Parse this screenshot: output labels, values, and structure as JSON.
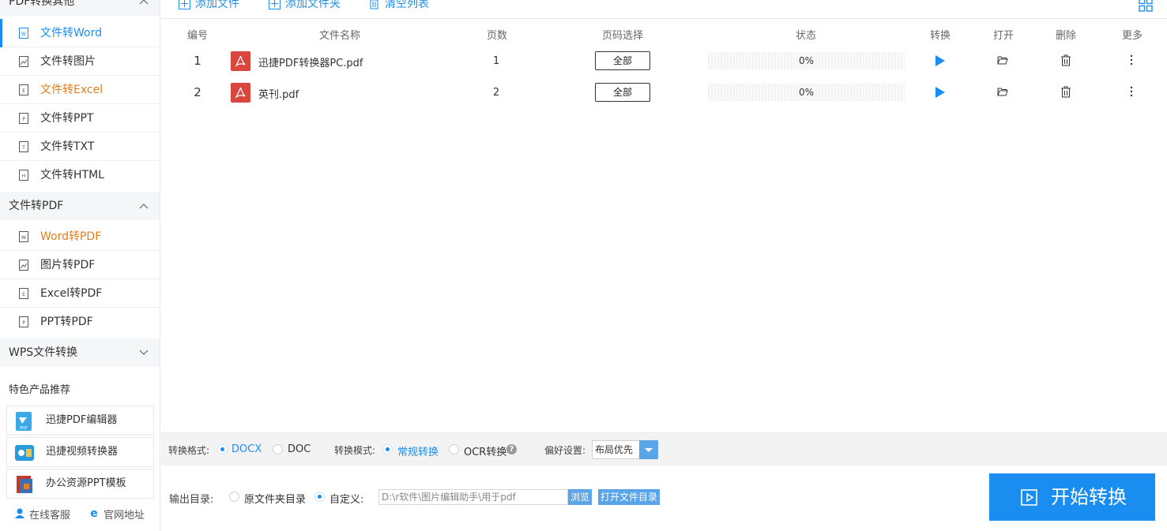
{
  "sidebar": {
    "sections": [
      {
        "title": "PDF转换其他"
      },
      {
        "title": "文件转PDF"
      },
      {
        "title": "WPS文件转换"
      }
    ],
    "items": [
      {
        "label": "文件转Word",
        "icon": "W"
      },
      {
        "label": "文件转图片",
        "icon": "img"
      },
      {
        "label": "文件转Excel",
        "icon": "E"
      },
      {
        "label": "文件转PPT",
        "icon": "P"
      },
      {
        "label": "文件转TXT",
        "icon": "T"
      },
      {
        "label": "文件转HTML",
        "icon": "H"
      },
      {
        "label": "Word转PDF",
        "icon": "W"
      },
      {
        "label": "图片转PDF",
        "icon": "img"
      },
      {
        "label": "Excel转PDF",
        "icon": "E"
      },
      {
        "label": "PPT转PDF",
        "icon": "P"
      }
    ],
    "featured_title": "特色产品推荐",
    "featured": [
      {
        "label": "迅捷PDF编辑器",
        "icon": "pdf-editor-icon"
      },
      {
        "label": "迅捷视频转换器",
        "icon": "video-converter-icon"
      },
      {
        "label": "办公资源PPT模板",
        "icon": "ppt-template-icon"
      }
    ],
    "footer": {
      "support": "在线客服",
      "website": "官网地址"
    }
  },
  "toolbar": {
    "add_file": "添加文件",
    "add_folder": "添加文件夹",
    "clear_list": "清空列表"
  },
  "table": {
    "headers": [
      "编号",
      "文件名称",
      "页数",
      "页码选择",
      "状态",
      "转换",
      "打开",
      "删除",
      "更多"
    ],
    "rows": [
      {
        "num": "1",
        "name": "迅捷PDF转换器PC.pdf",
        "pages": "1",
        "page_select": "全部",
        "status": "0%"
      },
      {
        "num": "2",
        "name": "英刊.pdf",
        "pages": "2",
        "page_select": "全部",
        "status": "0%"
      }
    ]
  },
  "options": {
    "format_label": "转换格式:",
    "formats": [
      "DOCX",
      "DOC"
    ],
    "format_selected": "DOCX",
    "mode_label": "转换模式:",
    "modes": [
      "常规转换",
      "OCR转换"
    ],
    "mode_selected": "常规转换",
    "pref_label": "偏好设置:",
    "pref_value": "布局优先"
  },
  "output": {
    "label": "输出目录:",
    "opt_original": "原文件夹目录",
    "opt_custom": "自定义:",
    "path": "D:\\r软件\\图片编辑助手\\用于pdf",
    "browse": "浏览",
    "open_dir": "打开文件目录"
  },
  "start_label": "开始转换",
  "colors": {
    "accent": "#1a8df0",
    "orange": "#e07e1a",
    "pdf_red": "#d9463e"
  }
}
